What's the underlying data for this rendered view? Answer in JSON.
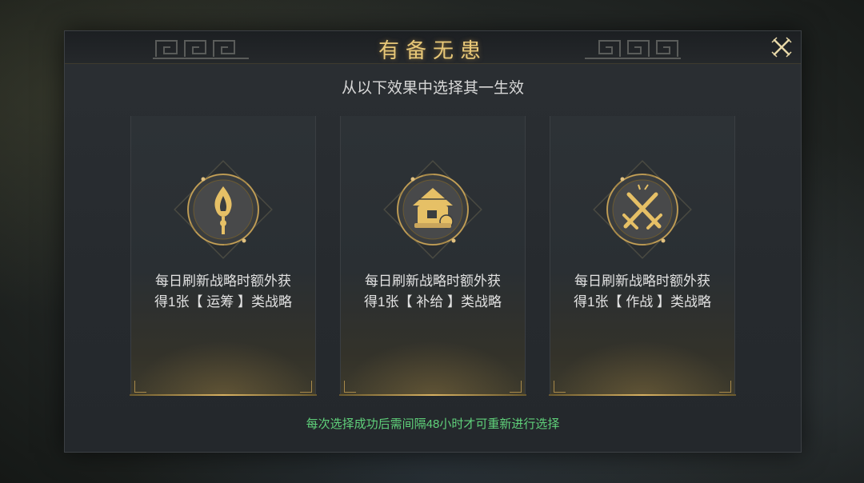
{
  "dialog": {
    "title": "有备无患",
    "subtitle": "从以下效果中选择其一生效",
    "footer_note": "每次选择成功后需间隔48小时才可重新进行选择"
  },
  "cards": [
    {
      "icon": "flame-torch-icon",
      "desc_line1": "每日刷新战略时额外获",
      "desc_line2": "得1张【 运筹 】类战略"
    },
    {
      "icon": "supply-granary-icon",
      "desc_line1": "每日刷新战略时额外获",
      "desc_line2": "得1张【 补给 】类战略"
    },
    {
      "icon": "crossed-swords-icon",
      "desc_line1": "每日刷新战略时额外获",
      "desc_line2": "得1张【 作战 】类战略"
    }
  ],
  "colors": {
    "accent_gold": "#e8c878",
    "note_green": "#5fd07a",
    "text_light": "#e2e2e2"
  },
  "icons": {
    "close": "close-x-icon",
    "ornament": "meander-ornament-icon"
  }
}
